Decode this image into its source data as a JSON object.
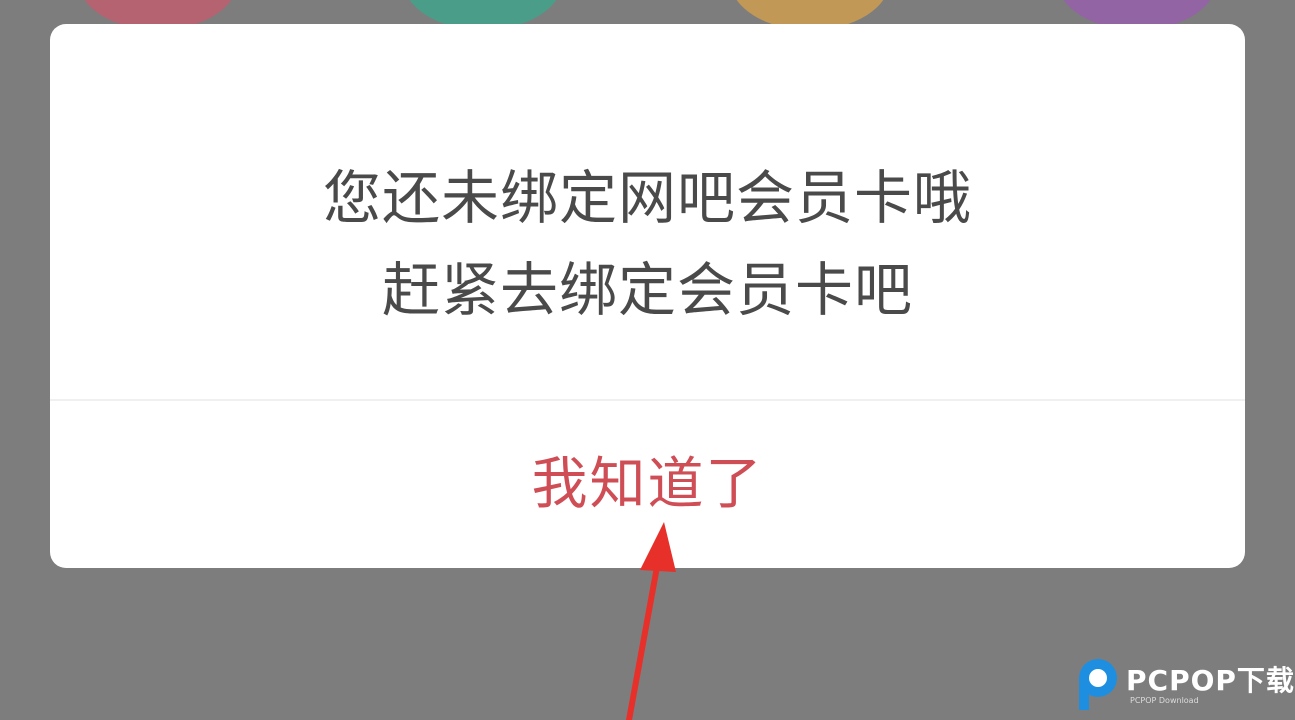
{
  "dialog": {
    "message_line1": "您还未绑定网吧会员卡哦",
    "message_line2": "赶紧去绑定会员卡吧",
    "confirm_label": "我知道了"
  },
  "colors": {
    "overlay": "#7d7d7d",
    "dialog_bg": "#ffffff",
    "message_text": "#4a4a4a",
    "confirm_text": "#cf4d55",
    "annotation_arrow": "#e8302a",
    "watermark_blue": "#1e8fe0"
  },
  "background_circles": [
    "#c85a6e",
    "#3aa88c",
    "#d8a24a",
    "#9a5cb0"
  ],
  "annotation": {
    "icon": "red-arrow-icon"
  },
  "watermark": {
    "icon": "pcpop-logo-icon",
    "text": "PCPOP下载",
    "subtext": "PCPOP Download"
  }
}
